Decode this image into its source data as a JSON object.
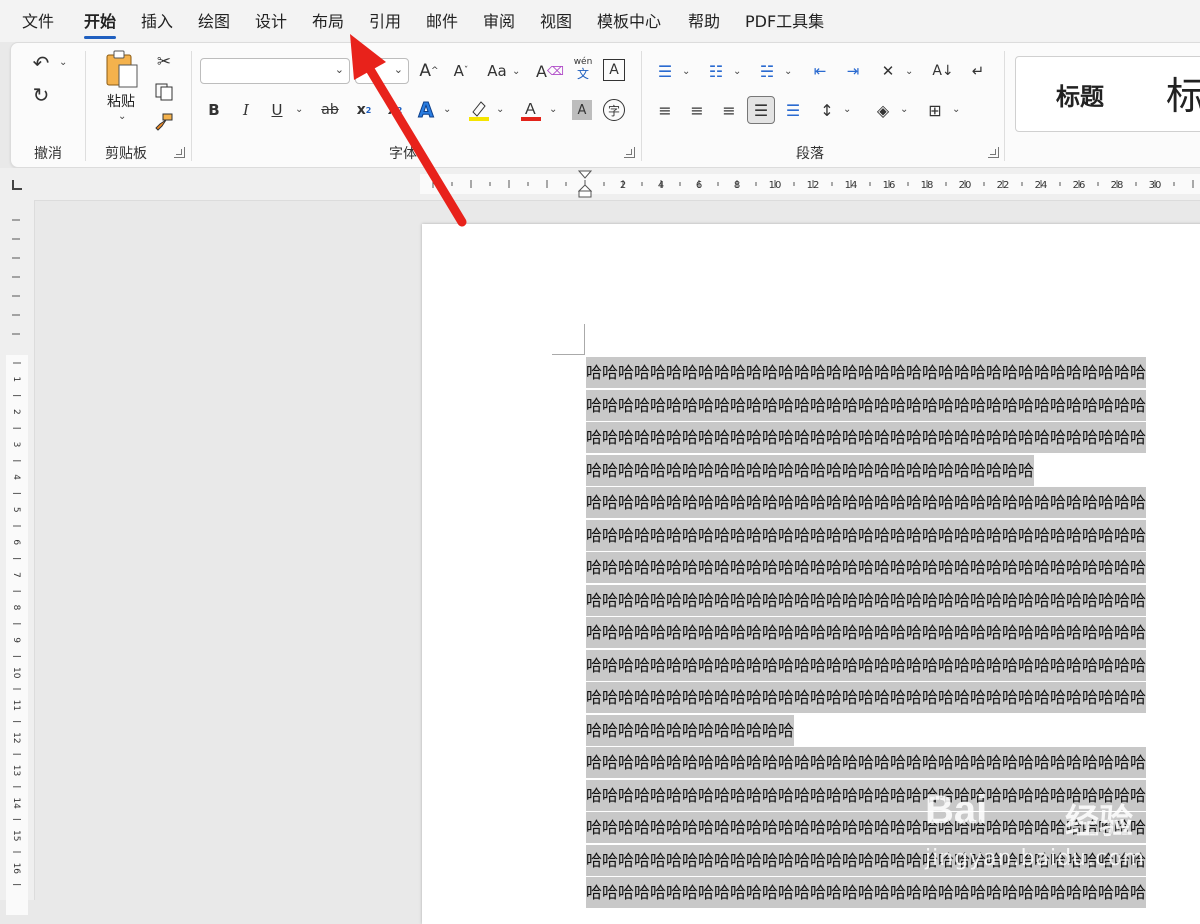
{
  "tabs": [
    {
      "label": "文件"
    },
    {
      "label": "开始"
    },
    {
      "label": "插入"
    },
    {
      "label": "绘图"
    },
    {
      "label": "设计"
    },
    {
      "label": "布局"
    },
    {
      "label": "引用"
    },
    {
      "label": "邮件"
    },
    {
      "label": "审阅"
    },
    {
      "label": "视图"
    },
    {
      "label": "模板中心"
    },
    {
      "label": "帮助"
    },
    {
      "label": "PDF工具集"
    }
  ],
  "active_tab": "开始",
  "ribbon": {
    "undo_group": {
      "label": "撤消"
    },
    "clipboard_group": {
      "label": "剪贴板",
      "paste_label": "粘贴"
    },
    "font_group": {
      "label": "字体",
      "font_name": "",
      "font_size": "",
      "phonetic_top": "wén",
      "phonetic_bottom": "文"
    },
    "paragraph_group": {
      "label": "段落"
    },
    "styles_gallery": {
      "items": [
        "标题",
        "标"
      ]
    }
  },
  "ruler_labels": [
    "2",
    "4",
    "6",
    "8",
    "10",
    "12",
    "14",
    "16",
    "18",
    "20",
    "22",
    "24",
    "26",
    "28",
    "30"
  ],
  "v_ruler_labels": [
    "1",
    "2",
    "3",
    "4",
    "5",
    "6",
    "7",
    "8",
    "9",
    "10",
    "11",
    "12",
    "13",
    "14",
    "15",
    "16"
  ],
  "document": {
    "lines": [
      "哈哈哈哈哈哈哈哈哈哈哈哈哈哈哈哈哈哈哈哈哈哈哈哈哈哈哈哈哈哈哈哈哈哈哈",
      "哈哈哈哈哈哈哈哈哈哈哈哈哈哈哈哈哈哈哈哈哈哈哈哈哈哈哈哈哈哈哈哈哈哈哈",
      "哈哈哈哈哈哈哈哈哈哈哈哈哈哈哈哈哈哈哈哈哈哈哈哈哈哈哈哈哈哈哈哈哈哈哈",
      "哈哈哈哈哈哈哈哈哈哈哈哈哈哈哈哈哈哈哈哈哈哈哈哈哈哈哈哈",
      "哈哈哈哈哈哈哈哈哈哈哈哈哈哈哈哈哈哈哈哈哈哈哈哈哈哈哈哈哈哈哈哈哈哈哈",
      "哈哈哈哈哈哈哈哈哈哈哈哈哈哈哈哈哈哈哈哈哈哈哈哈哈哈哈哈哈哈哈哈哈哈哈",
      "哈哈哈哈哈哈哈哈哈哈哈哈哈哈哈哈哈哈哈哈哈哈哈哈哈哈哈哈哈哈哈哈哈哈哈",
      "哈哈哈哈哈哈哈哈哈哈哈哈哈哈哈哈哈哈哈哈哈哈哈哈哈哈哈哈哈哈哈哈哈哈哈",
      "哈哈哈哈哈哈哈哈哈哈哈哈哈哈哈哈哈哈哈哈哈哈哈哈哈哈哈哈哈哈哈哈哈哈哈",
      "哈哈哈哈哈哈哈哈哈哈哈哈哈哈哈哈哈哈哈哈哈哈哈哈哈哈哈哈哈哈哈哈哈哈哈",
      "哈哈哈哈哈哈哈哈哈哈哈哈哈哈哈哈哈哈哈哈哈哈哈哈哈哈哈哈哈哈哈哈哈哈哈",
      "哈哈哈哈哈哈哈哈哈哈哈哈哈",
      "哈哈哈哈哈哈哈哈哈哈哈哈哈哈哈哈哈哈哈哈哈哈哈哈哈哈哈哈哈哈哈哈哈哈哈",
      "哈哈哈哈哈哈哈哈哈哈哈哈哈哈哈哈哈哈哈哈哈哈哈哈哈哈哈哈哈哈哈哈哈哈哈",
      "哈哈哈哈哈哈哈哈哈哈哈哈哈哈哈哈哈哈哈哈哈哈哈哈哈哈哈哈哈哈哈哈哈哈哈",
      "哈哈哈哈哈哈哈哈哈哈哈哈哈哈哈哈哈哈哈哈哈哈哈哈哈哈哈哈哈哈哈哈哈哈哈",
      "哈哈哈哈哈哈哈哈哈哈哈哈哈哈哈哈哈哈哈哈哈哈哈哈哈哈哈哈哈哈哈哈哈哈哈"
    ],
    "full_line_flags": [
      true,
      true,
      true,
      false,
      true,
      true,
      true,
      true,
      true,
      true,
      true,
      false,
      true,
      true,
      true,
      true,
      true
    ]
  },
  "watermark": {
    "logo": "Bai",
    "name": "经验",
    "url": "jingyan.baidu.com"
  },
  "colors": {
    "accent": "#1f5fbf",
    "selection": "#c8c8c8",
    "annotation_arrow": "#e8221b",
    "highlight_yellow": "#f5e400",
    "font_red": "#e2231a"
  }
}
